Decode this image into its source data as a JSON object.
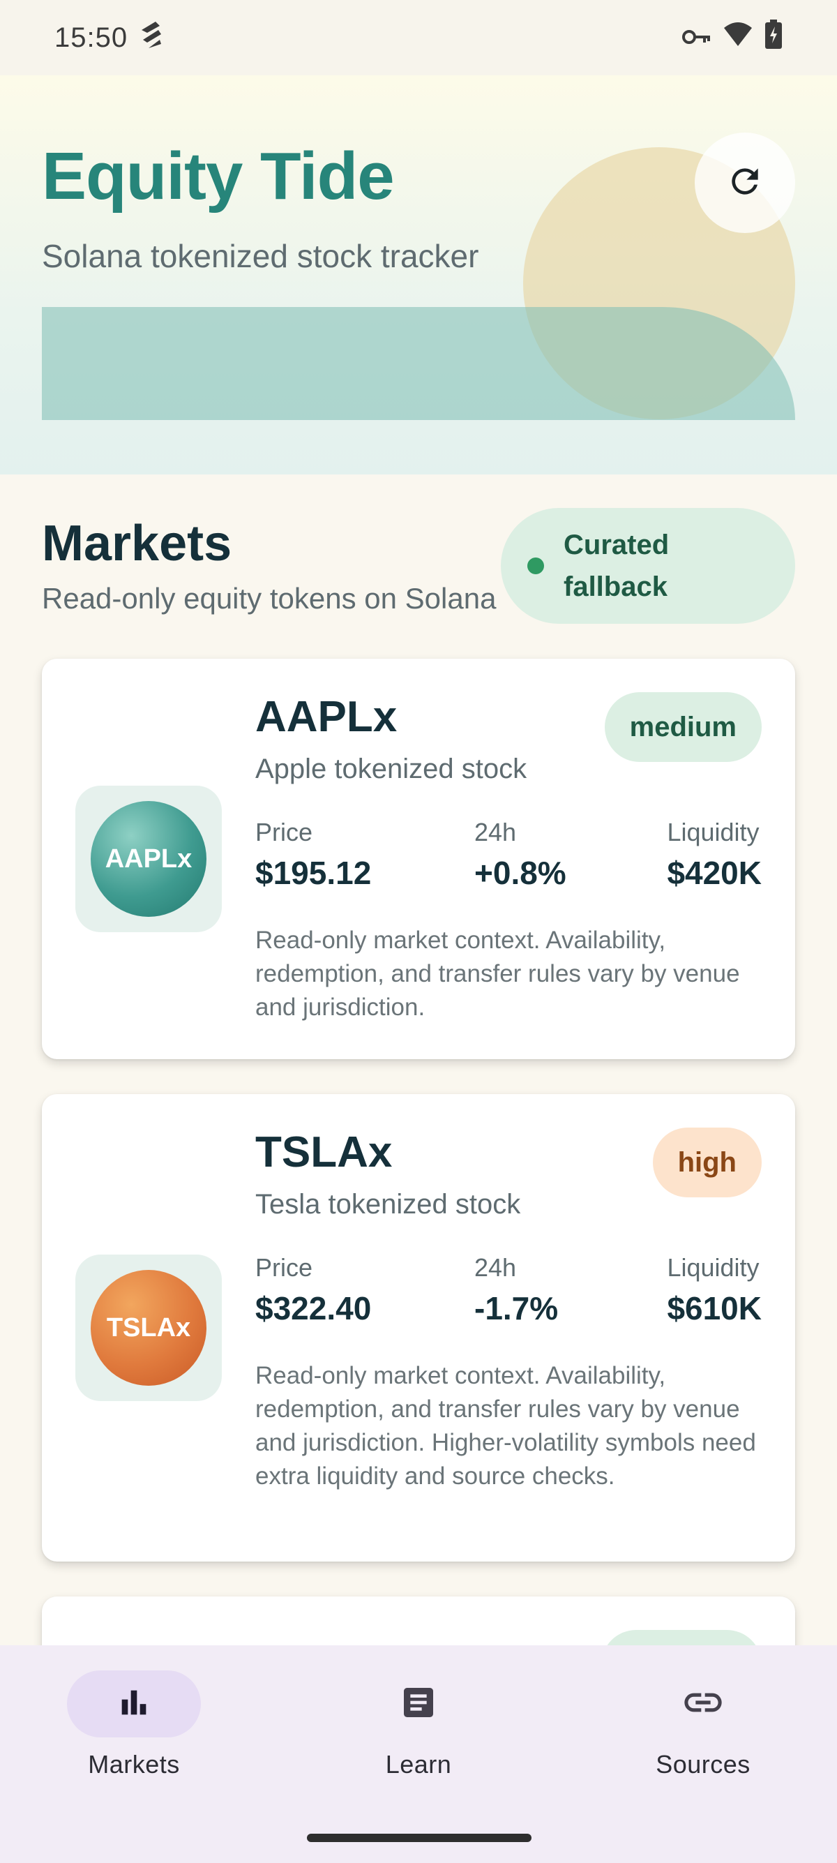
{
  "status_bar": {
    "time": "15:50",
    "icons": [
      "network-activity-icon",
      "vpn-key-icon",
      "wifi-icon",
      "battery-charging-icon"
    ]
  },
  "hero": {
    "title": "Equity Tide",
    "subtitle": "Solana tokenized stock tracker",
    "refresh_icon": "refresh-icon"
  },
  "markets": {
    "title": "Markets",
    "subtitle": "Read-only equity tokens on Solana",
    "data_source_badge": "Curated fallback"
  },
  "tokens": [
    {
      "symbol": "AAPLx",
      "name": "Apple tokenized stock",
      "risk": "medium",
      "price_label": "Price",
      "price": "$195.12",
      "change_label": "24h",
      "change": "+0.8%",
      "liquidity_label": "Liquidity",
      "liquidity": "$420K",
      "note": "Read-only market context. Availability, redemption, and transfer rules vary by venue and jurisdiction.",
      "accent": "#3f9b90"
    },
    {
      "symbol": "TSLAx",
      "name": "Tesla tokenized stock",
      "risk": "high",
      "price_label": "Price",
      "price": "$322.40",
      "change_label": "24h",
      "change": "-1.7%",
      "liquidity_label": "Liquidity",
      "liquidity": "$610K",
      "note": "Read-only market context. Availability, redemption, and transfer rules vary by venue and jurisdiction. Higher-volatility symbols need extra liquidity and source checks.",
      "accent": "#e07a3d"
    }
  ],
  "nav": [
    {
      "label": "Markets",
      "icon": "bar-chart-icon",
      "active": true
    },
    {
      "label": "Learn",
      "icon": "article-icon",
      "active": false
    },
    {
      "label": "Sources",
      "icon": "link-icon",
      "active": false
    }
  ],
  "colors": {
    "brand": "#27857a",
    "background": "#faf7ef",
    "nav_background": "#f2ecf6",
    "medium_badge": "#dcefe3",
    "high_badge": "#fde3cc"
  }
}
